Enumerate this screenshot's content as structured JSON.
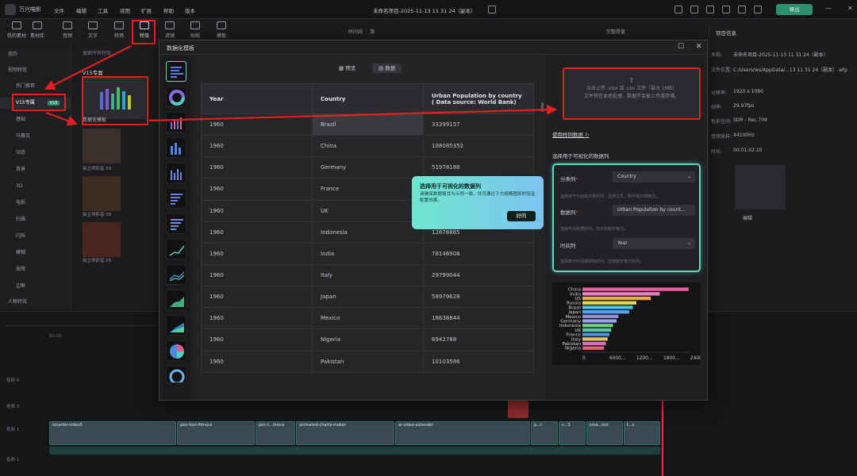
{
  "app": {
    "name": "万兴喵影",
    "menu": [
      "文件",
      "编辑",
      "工具",
      "视图",
      "扩展",
      "帮助",
      "版本"
    ],
    "project_title": "未命名项目-2025-11-13 11 31 24（副本）",
    "export_label": "导出"
  },
  "tools": [
    "我的素材",
    "素材库",
    "音频",
    "文字",
    "转场",
    "特效",
    "滤镜",
    "贴纸",
    "模板"
  ],
  "left_nav": [
    "我的",
    "视频特效",
    "热门推荐",
    "V15专属",
    "V15",
    "基础",
    "马赛克",
    "动态",
    "背景",
    "3D",
    "电影",
    "扫描",
    "闪烁",
    "模糊",
    "故障",
    "边框",
    "人物特效"
  ],
  "effects": {
    "search_placeholder": "搜索所有特效",
    "section": "V15专属",
    "item_label": "数据化模板",
    "thumbs": [
      "拍立得影音 03",
      "拍立得影音 08",
      "拍立得影音 05"
    ]
  },
  "preview": {
    "tab1": "时间线",
    "tab2": "源",
    "quality": "完整质量"
  },
  "right_panel": {
    "title": "项目信息",
    "rows": [
      {
        "k": "名称:",
        "v": "未命名项目-2025-11-13 11 31 24（副本）"
      },
      {
        "k": "文件位置:",
        "v": "C:/Users/ws/AppData/...13 11 31 24（副本）.wfp"
      },
      {
        "k": "分辨率:",
        "v": "1920 x 1080"
      },
      {
        "k": "帧率:",
        "v": "29.97fps"
      },
      {
        "k": "色彩空间:",
        "v": "SDR - Rec.709"
      },
      {
        "k": "音频采样:",
        "v": "44100Hz"
      },
      {
        "k": "时长:",
        "v": "00:01:02:10"
      }
    ],
    "edit_label": "编辑"
  },
  "modal": {
    "title": "数据化模板",
    "tab_preview": "预览",
    "tab_data": "数据",
    "columns": [
      "Year",
      "Country",
      "Urban Population by country ( Data source: World Bank)"
    ],
    "rows": [
      [
        "1960",
        "Brazil",
        "33399157"
      ],
      [
        "1960",
        "China",
        "108085352"
      ],
      [
        "1960",
        "Germany",
        "51978188"
      ],
      [
        "1960",
        "France",
        ""
      ],
      [
        "1960",
        "UK",
        ""
      ],
      [
        "1960",
        "Indonesia",
        "12878865"
      ],
      [
        "1960",
        "India",
        "78146908"
      ],
      [
        "1960",
        "Italy",
        "29799044"
      ],
      [
        "1960",
        "Japan",
        "58979628"
      ],
      [
        "1960",
        "Mexico",
        "18638844"
      ],
      [
        "1960",
        "Nigeria",
        "6942788"
      ],
      [
        "1960",
        "Pakistan",
        "10103586"
      ]
    ],
    "upload_line1": "点击上传 .xlsx 或 .csv 文件（最大 1MB）",
    "upload_line2": "文件将在本地处理，数据不会被上传或存储。",
    "use_example": "使用样例数据",
    "select_columns": "选择用于可视化的数据列",
    "category_label": "分类列",
    "category_value": "Country",
    "category_hint": "选择用于分组或分类的列，支持文本、数字或日期格式。",
    "data_label": "数据列",
    "data_value": "Urban Population by count...",
    "data_hint": "选择作为数据的列，仅支持数字格式。",
    "time_label": "时间列",
    "time_value": "Year",
    "time_hint": "选择表示时间或顺序的列，支持数字格式的列。",
    "required_mark": "*"
  },
  "tooltip": {
    "title": "选择用于可视化的数据列",
    "body": "请确保数据格式与示例一致，并可通过下方缩略图即时验证配置效果。",
    "ok": "好的"
  },
  "chart_data": {
    "type": "bar",
    "orientation": "horizontal",
    "categories": [
      "China",
      "India",
      "US",
      "Russia",
      "Brazil",
      "Japan",
      "Mexico",
      "Germany",
      "Indonesia",
      "UK",
      "France",
      "Italy",
      "Pakistan",
      "Nigeria"
    ],
    "values": [
      2950,
      2150,
      1900,
      1500,
      1400,
      1300,
      1000,
      950,
      850,
      800,
      750,
      700,
      650,
      600
    ],
    "xticks": [
      "0",
      "6000...",
      "1200...",
      "1800...",
      "24003000..."
    ],
    "colors": [
      "#e8609f",
      "#e87cc6",
      "#f0a64a",
      "#e0dc5a",
      "#4fc3d9",
      "#5a9ef0",
      "#8d8fe0",
      "#9aa0e6",
      "#6fd07a",
      "#56c8a8",
      "#4a90e0",
      "#e8c060",
      "#d070c0",
      "#e86070"
    ]
  },
  "timeline": {
    "ruler_start": "00:00",
    "tracks": [
      "视频 4",
      "视频 3",
      "视频 2",
      "视频 1",
      "音频 1"
    ],
    "clips": [
      "smarter-video5",
      "pen-tool-filmora",
      "pen-t...lmora",
      "animated-charts-maker",
      "ai-video-extender",
      "p...r",
      "s...3",
      "sma...out",
      "t...s"
    ]
  }
}
